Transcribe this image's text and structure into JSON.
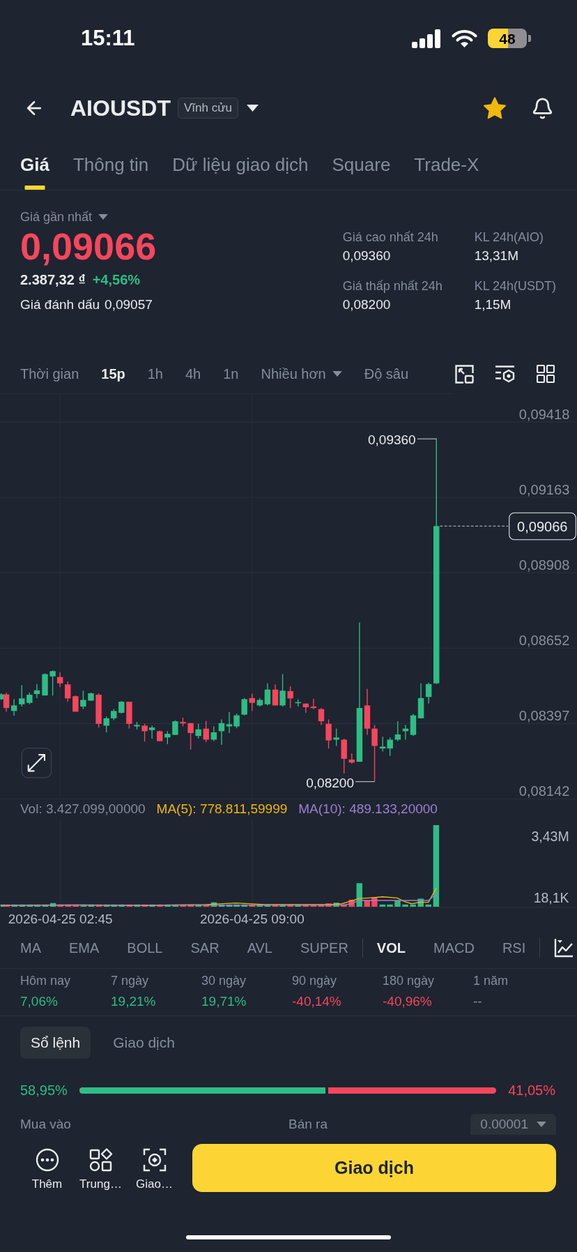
{
  "status_bar": {
    "time": "15:11",
    "battery": "48"
  },
  "header": {
    "symbol": "AIOUSDT",
    "contract_badge": "Vĩnh cửu",
    "favorite": true
  },
  "tabs": [
    {
      "label": "Giá",
      "selected": true
    },
    {
      "label": "Thông tin",
      "selected": false
    },
    {
      "label": "Dữ liệu giao dịch",
      "selected": false
    },
    {
      "label": "Square",
      "selected": false
    },
    {
      "label": "Trade-X",
      "selected": false
    }
  ],
  "price_panel": {
    "price_type": "Giá gần nhất",
    "last_price": "0,09066",
    "fiat_value": "2.387,32 ₫",
    "change": {
      "text": "+4,56%",
      "color": "#2ebd85"
    },
    "mark_price_label": "Giá đánh dấu",
    "mark_price": "0,09057",
    "stats": [
      {
        "label": "Giá cao nhất 24h",
        "value": "0,09360"
      },
      {
        "label": "KL 24h(AIO)",
        "value": "13,31M"
      },
      {
        "label": "Giá thấp nhất 24h",
        "value": "0,08200"
      },
      {
        "label": "KL 24h(USDT)",
        "value": "1,15M"
      }
    ]
  },
  "chart_toolbar": [
    {
      "label": "Thời gian",
      "kind": "tab",
      "selected": false
    },
    {
      "label": "15p",
      "kind": "tab",
      "selected": true
    },
    {
      "label": "1h",
      "kind": "tab",
      "selected": false
    },
    {
      "label": "4h",
      "kind": "tab",
      "selected": false
    },
    {
      "label": "1n",
      "kind": "tab",
      "selected": false
    },
    {
      "label": "Nhiều hơn",
      "kind": "dropdown",
      "selected": false
    },
    {
      "label": "Độ sâu",
      "kind": "tab",
      "selected": false
    }
  ],
  "price_chart": {
    "axis_labels": [
      "0,09418",
      "0,09163",
      "0,08908",
      "0,08652",
      "0,08397",
      "0,08142"
    ],
    "high_label": "0,09360",
    "low_label": "0,08200",
    "last_price_tag": "0,09066"
  },
  "volume_chart": {
    "legend": [
      {
        "text": "Vol: 3.427.099,00000",
        "color": "#848e9c"
      },
      {
        "text": "MA(5): 778.811,59999",
        "color": "#f0b90b"
      },
      {
        "text": "MA(10): 489.133,20000",
        "color": "#9d80d4"
      }
    ],
    "axis_labels": [
      "3,43M",
      "18,1K"
    ],
    "time_labels": [
      "2026-04-25 02:45",
      "2026-04-25 09:00"
    ]
  },
  "indicators": {
    "main": [
      {
        "label": "MA",
        "selected": false
      },
      {
        "label": "EMA",
        "selected": false
      },
      {
        "label": "BOLL",
        "selected": false
      },
      {
        "label": "SAR",
        "selected": false
      },
      {
        "label": "AVL",
        "selected": false
      },
      {
        "label": "SUPER",
        "selected": false
      }
    ],
    "sub": [
      {
        "label": "VOL",
        "selected": true
      },
      {
        "label": "MACD",
        "selected": false
      },
      {
        "label": "RSI",
        "selected": false
      }
    ]
  },
  "performance": [
    {
      "label": "Hôm nay",
      "value": "7,06%",
      "color": "#2ebd85"
    },
    {
      "label": "7 ngày",
      "value": "19,21%",
      "color": "#2ebd85"
    },
    {
      "label": "30 ngày",
      "value": "19,71%",
      "color": "#2ebd85"
    },
    {
      "label": "90 ngày",
      "value": "-40,14%",
      "color": "#f6465d"
    },
    {
      "label": "180 ngày",
      "value": "-40,96%",
      "color": "#f6465d"
    },
    {
      "label": "1 năm",
      "value": "--",
      "color": "#848e9c"
    }
  ],
  "order_book": {
    "tabs": [
      {
        "label": "Sổ lệnh",
        "selected": true
      },
      {
        "label": "Giao dịch",
        "selected": false
      }
    ],
    "buy_share": "58,95%",
    "sell_share": "41,05%",
    "level": 0.5895,
    "buy_label": "Mua vào",
    "sell_label": "Bán ra",
    "precision": "0.00001"
  },
  "bottom_bar": {
    "actions": [
      {
        "label": "Thêm",
        "kind": "more"
      },
      {
        "label": "Trung…",
        "kind": "hub"
      },
      {
        "label": "Giao…",
        "kind": "scan"
      }
    ],
    "primary_button": "Giao dịch"
  }
}
